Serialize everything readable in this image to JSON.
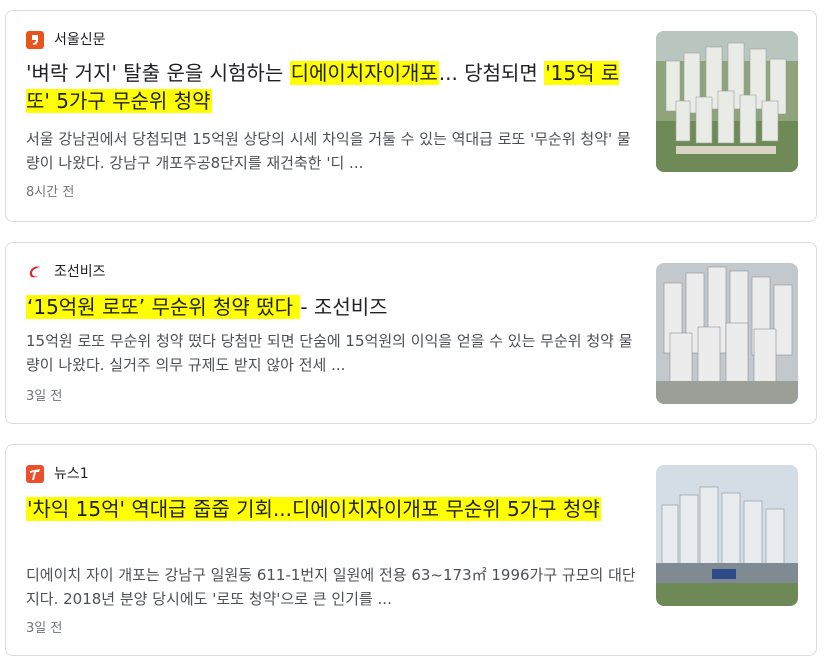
{
  "articles": [
    {
      "source": "서울신문",
      "source_icon": "seoul-shinmun-logo-icon",
      "source_color": "#e8541e",
      "title_pre": "'벼락 거지' 탈출 운을 시험하는 ",
      "title_hl1": "디에이치자이개포",
      "title_mid": "... 당첨되면 ",
      "title_hl2": "'15억 로또' 5가구 무순위 청약",
      "snippet": "서울 강남권에서 당첨되면 15억원 상당의 시세 차익을 거둘 수 있는 역대급 로또 '무순위 청약' 물량이 나왔다. 강남구 개포주공8단지를 재건축한 '디 ...",
      "time": "8시간 전"
    },
    {
      "source": "조선비즈",
      "source_icon": "chosun-biz-logo-icon",
      "source_color": "#e3262c",
      "title_hl1": "‘15억원 로또’ 무순위 청약 떴다 ",
      "title_post": "- 조선비즈",
      "snippet": "15억원 로또 무순위 청약 떴다 당첨만 되면 단숨에 15억원의 이익을 얻을 수 있는 무순위 청약 물량이 나왔다. 실거주 의무 규제도 받지 않아 전세 ...",
      "time": "3일 전"
    },
    {
      "source": "뉴스1",
      "source_icon": "news1-logo-icon",
      "source_color": "#ec4f2b",
      "title_hl1": "'차익 15억' 역대급 줍줍 기회...디에이치자이개포 무순위 5가구 청약",
      "snippet": "디에이치 자이 개포는 강남구 일원동 611-1번지 일원에 전용 63~173㎡ 1996가구 규모의 대단지다. 2018년 분양 당시에도 '로또 청약'으로 큰 인기를 ...",
      "time": "3일 전"
    }
  ]
}
